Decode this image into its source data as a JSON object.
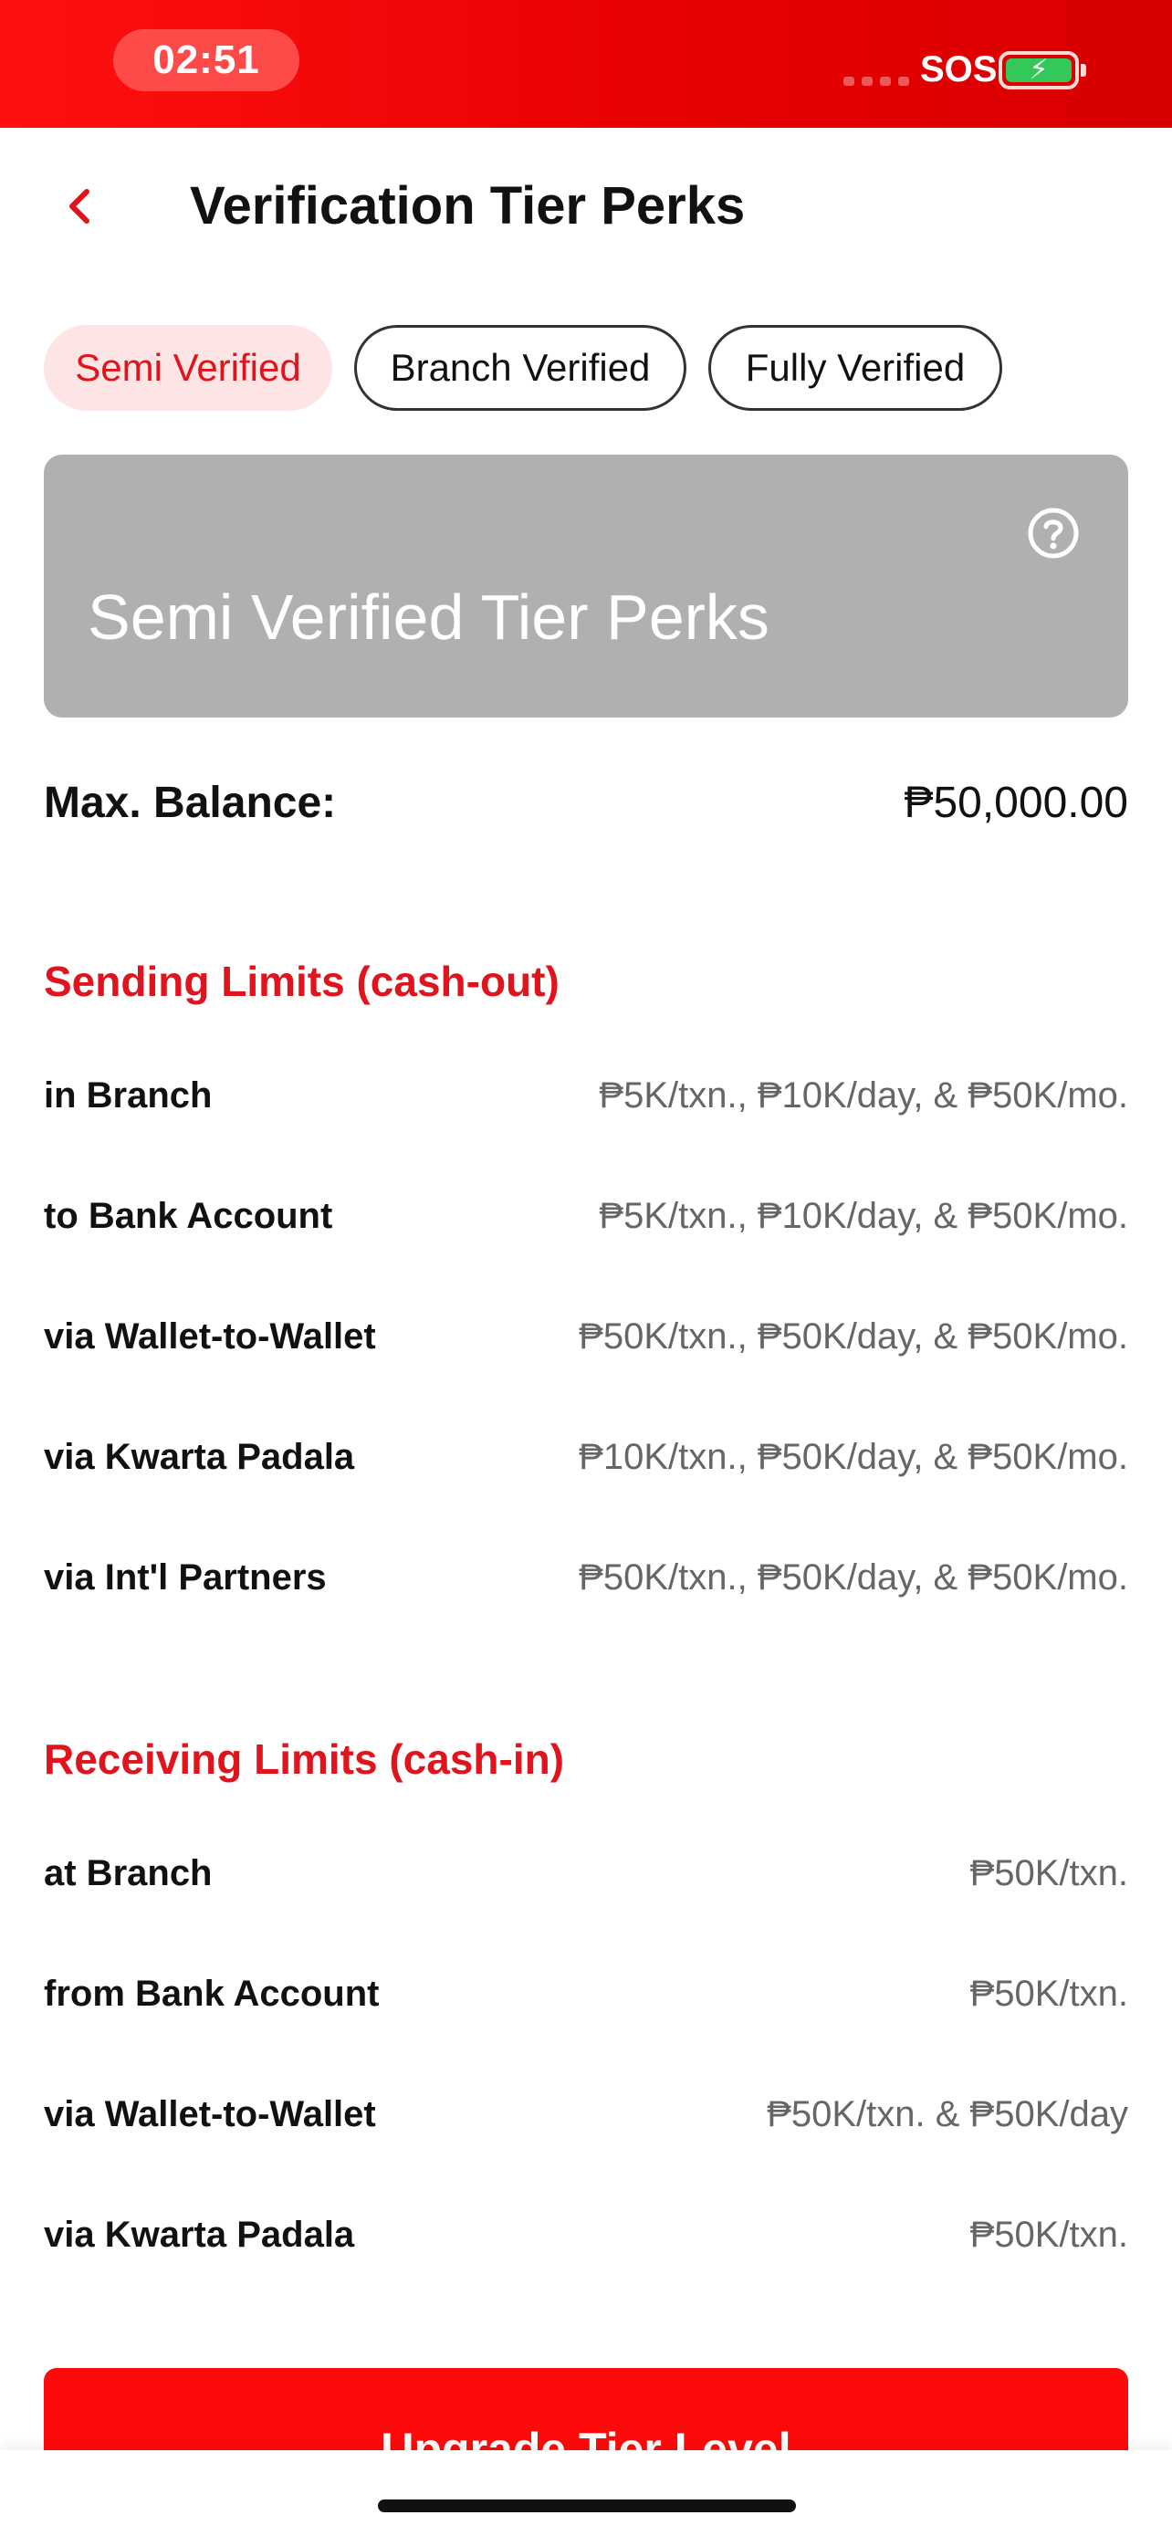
{
  "status_bar": {
    "time": "02:51",
    "carrier": "SOS",
    "battery_symbol": "⚡"
  },
  "header": {
    "title": "Verification Tier Perks"
  },
  "tabs": [
    {
      "label": "Semi Verified",
      "active": true
    },
    {
      "label": "Branch Verified",
      "active": false
    },
    {
      "label": "Fully Verified",
      "active": false
    }
  ],
  "banner": {
    "title": "Semi Verified Tier Perks",
    "help_icon": "question-circle-icon"
  },
  "max_balance": {
    "label": "Max. Balance:",
    "value": "₱50,000.00"
  },
  "sending": {
    "title": "Sending Limits (cash-out)",
    "rows": [
      {
        "label": "in Branch",
        "value": "₱5K/txn., ₱10K/day, & ₱50K/mo."
      },
      {
        "label": "to Bank Account",
        "value": "₱5K/txn., ₱10K/day, & ₱50K/mo."
      },
      {
        "label": "via Wallet-to-Wallet",
        "value": "₱50K/txn., ₱50K/day, & ₱50K/mo."
      },
      {
        "label": "via Kwarta Padala",
        "value": "₱10K/txn., ₱50K/day, & ₱50K/mo."
      },
      {
        "label": "via Int'l Partners",
        "value": "₱50K/txn., ₱50K/day, & ₱50K/mo."
      }
    ]
  },
  "receiving": {
    "title": "Receiving Limits (cash-in)",
    "rows": [
      {
        "label": "at Branch",
        "value": "₱50K/txn."
      },
      {
        "label": "from Bank Account",
        "value": "₱50K/txn."
      },
      {
        "label": "via Wallet-to-Wallet",
        "value": "₱50K/txn. & ₱50K/day"
      },
      {
        "label": "via Kwarta Padala",
        "value": "₱50K/txn."
      }
    ]
  },
  "cta": {
    "label": "Upgrade Tier Level"
  },
  "colors": {
    "brand_red": "#e0141c",
    "banner_gray": "#b0b0b0",
    "active_tab_bg": "#fde5e5"
  }
}
